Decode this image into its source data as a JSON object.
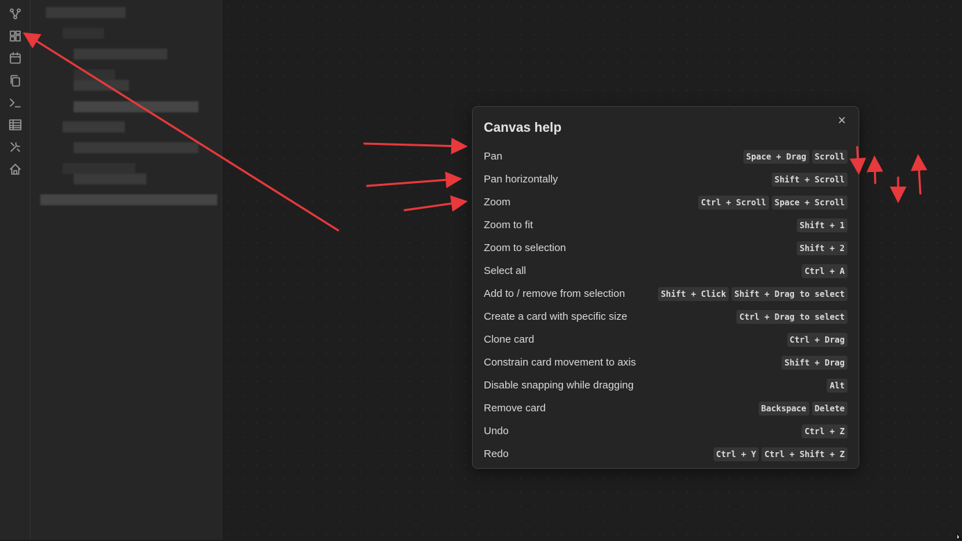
{
  "ribbon": {
    "icons": [
      "graph-icon",
      "dashboard-icon",
      "calendar-icon",
      "copy-icon",
      "terminal-icon",
      "table-icon",
      "tools-icon",
      "home-icon"
    ]
  },
  "modal": {
    "title": "Canvas help",
    "close_label": "×",
    "rows": [
      {
        "label": "Pan",
        "keys": [
          "Space + Drag",
          "Scroll"
        ]
      },
      {
        "label": "Pan horizontally",
        "keys": [
          "Shift + Scroll"
        ]
      },
      {
        "label": "Zoom",
        "keys": [
          "Ctrl + Scroll",
          "Space + Scroll"
        ]
      },
      {
        "label": "Zoom to fit",
        "keys": [
          "Shift + 1"
        ]
      },
      {
        "label": "Zoom to selection",
        "keys": [
          "Shift + 2"
        ]
      },
      {
        "label": "Select all",
        "keys": [
          "Ctrl + A"
        ]
      },
      {
        "label": "Add to / remove from selection",
        "keys": [
          "Shift + Click",
          "Shift + Drag to select"
        ]
      },
      {
        "label": "Create a card with specific size",
        "keys": [
          "Ctrl + Drag to select"
        ]
      },
      {
        "label": "Clone card",
        "keys": [
          "Ctrl + Drag"
        ]
      },
      {
        "label": "Constrain card movement to axis",
        "keys": [
          "Shift + Drag"
        ]
      },
      {
        "label": "Disable snapping while dragging",
        "keys": [
          "Alt"
        ]
      },
      {
        "label": "Remove card",
        "keys": [
          "Backspace",
          "Delete"
        ]
      },
      {
        "label": "Undo",
        "keys": [
          "Ctrl + Z"
        ]
      },
      {
        "label": "Redo",
        "keys": [
          "Ctrl + Y",
          "Ctrl + Shift + Z"
        ]
      }
    ]
  },
  "colors": {
    "background": "#1e1e1e",
    "panel": "#262626",
    "modal": "#252525",
    "kbd": "#363636",
    "annotation": "#e8393c"
  }
}
